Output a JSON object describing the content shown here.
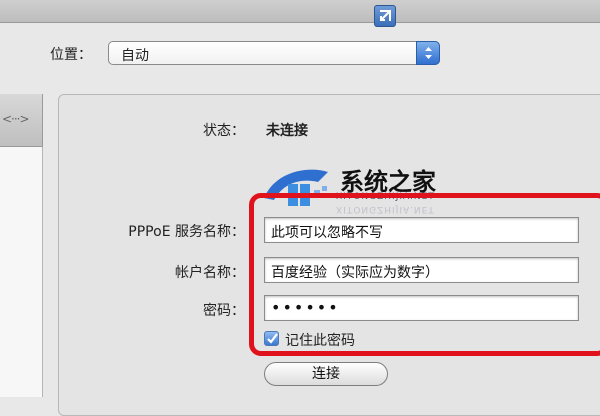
{
  "location": {
    "label": "位置：",
    "value": "自动"
  },
  "status": {
    "label": "状态：",
    "value": "未连接"
  },
  "watermark": {
    "brand": "系统之家",
    "site": "XITONGZHIJIA.NET"
  },
  "form": {
    "service_label": "PPPoE 服务名称：",
    "service_value": "此项可以忽略不写",
    "account_label": "帐户名称：",
    "account_value": "百度经验（实际应为数字）",
    "password_label": "密码：",
    "password_value": "••••••",
    "remember_label": "记住此密码",
    "remember_checked": true
  },
  "connect_button": "连接",
  "colors": {
    "highlight": "#e0121b",
    "accent": "#3c78cf"
  },
  "icons": [
    "resize-icon",
    "popup-arrows-icon",
    "checkmark-icon",
    "logo-icon"
  ]
}
